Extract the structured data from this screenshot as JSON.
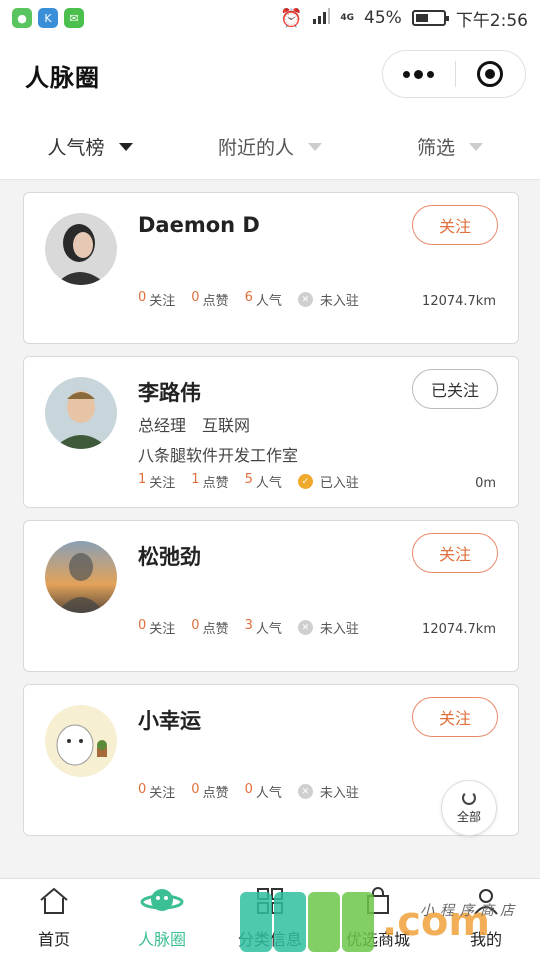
{
  "status_bar": {
    "network": "4G",
    "battery": "45%",
    "battery_level": 0.45,
    "time": "下午2:56"
  },
  "header": {
    "title": "人脉圈"
  },
  "filters": [
    {
      "label": "人气榜",
      "active": true
    },
    {
      "label": "附近的人",
      "active": false
    },
    {
      "label": "筛选",
      "active": false
    }
  ],
  "cards": [
    {
      "name": "Daemon D",
      "follow_label": "关注",
      "followed": false,
      "title_line": "",
      "company_line": "",
      "stats": {
        "follow_count": "0",
        "follow_label": "关注",
        "like_count": "0",
        "like_label": "点赞",
        "pop_count": "6",
        "pop_label": "人气"
      },
      "status": "未入驻",
      "distance": "12074.7km"
    },
    {
      "name": "李路伟",
      "follow_label": "已关注",
      "followed": true,
      "title_line": "总经理　互联网",
      "company_line": "八条腿软件开发工作室",
      "stats": {
        "follow_count": "1",
        "follow_label": "关注",
        "like_count": "1",
        "like_label": "点赞",
        "pop_count": "5",
        "pop_label": "人气"
      },
      "status": "已入驻",
      "distance": "0m"
    },
    {
      "name": "松弛劲",
      "follow_label": "关注",
      "followed": false,
      "title_line": "",
      "company_line": "",
      "stats": {
        "follow_count": "0",
        "follow_label": "关注",
        "like_count": "0",
        "like_label": "点赞",
        "pop_count": "3",
        "pop_label": "人气"
      },
      "status": "未入驻",
      "distance": "12074.7km"
    },
    {
      "name": "小幸运",
      "follow_label": "关注",
      "followed": false,
      "title_line": "",
      "company_line": "",
      "stats": {
        "follow_count": "0",
        "follow_label": "关注",
        "like_count": "0",
        "like_label": "点赞",
        "pop_count": "0",
        "pop_label": "人气"
      },
      "status": "未入驻",
      "distance": "120"
    }
  ],
  "fab": {
    "label": "全部"
  },
  "tabs": [
    {
      "label": "首页",
      "icon": "home-icon",
      "active": false
    },
    {
      "label": "人脉圈",
      "icon": "planet-icon",
      "active": true
    },
    {
      "label": "分类信息",
      "icon": "grid-icon",
      "active": false
    },
    {
      "label": "优选商城",
      "icon": "bag-icon",
      "active": false
    },
    {
      "label": "我的",
      "icon": "user-icon",
      "active": false
    }
  ],
  "watermark": {
    "text": ".com",
    "small": "小程序商店"
  },
  "colors": {
    "accent": "#3cbf94",
    "orange": "#e0703c",
    "badge_on": "#f0a92a",
    "badge_off": "#cfcfcf"
  }
}
